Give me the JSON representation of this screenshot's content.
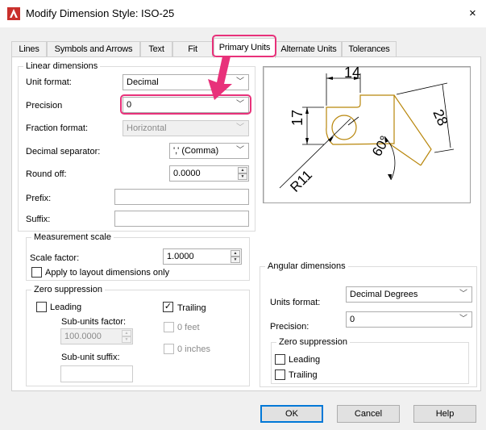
{
  "window": {
    "title": "Modify Dimension Style: ISO-25",
    "close": "×"
  },
  "tabs": [
    {
      "label": "Lines",
      "active": false
    },
    {
      "label": "Symbols and Arrows",
      "active": false
    },
    {
      "label": "Text",
      "active": false
    },
    {
      "label": "Fit",
      "active": false
    },
    {
      "label": "Primary Units",
      "active": true
    },
    {
      "label": "Alternate Units",
      "active": false
    },
    {
      "label": "Tolerances",
      "active": false
    }
  ],
  "linear": {
    "group_title": "Linear dimensions",
    "unit_format_label": "Unit format:",
    "unit_format_value": "Decimal",
    "precision_label": "Precision",
    "precision_value": "0",
    "fraction_format_label": "Fraction format:",
    "fraction_format_value": "Horizontal",
    "decimal_separator_label": "Decimal separator:",
    "decimal_separator_value": "',' (Comma)",
    "round_off_label": "Round off:",
    "round_off_value": "0.0000",
    "prefix_label": "Prefix:",
    "prefix_value": "",
    "suffix_label": "Suffix:",
    "suffix_value": ""
  },
  "measurement": {
    "group_title": "Measurement scale",
    "scale_factor_label": "Scale factor:",
    "scale_factor_value": "1.0000",
    "apply_layout_label": "Apply to layout dimensions only",
    "apply_layout_checked": false
  },
  "zero_suppression_linear": {
    "group_title": "Zero suppression",
    "leading_label": "Leading",
    "leading_checked": false,
    "trailing_label": "Trailing",
    "trailing_checked": true,
    "check_mark": "✓",
    "subunits_factor_label": "Sub-units factor:",
    "subunits_factor_value": "100.0000",
    "feet_label": "0 feet",
    "inches_label": "0 inches",
    "subunit_suffix_label": "Sub-unit suffix:",
    "subunit_suffix_value": ""
  },
  "angular": {
    "group_title": "Angular dimensions",
    "units_format_label": "Units format:",
    "units_format_value": "Decimal Degrees",
    "precision_label": "Precision:",
    "precision_value": "0",
    "zero_group_title": "Zero suppression",
    "leading_label": "Leading",
    "leading_checked": false,
    "trailing_label": "Trailing",
    "trailing_checked": false
  },
  "preview": {
    "dim_top": "14",
    "dim_left": "17",
    "dim_angle": "60°",
    "dim_diag": "28",
    "dim_radius": "R11"
  },
  "buttons": {
    "ok": "OK",
    "cancel": "Cancel",
    "help": "Help"
  },
  "colors": {
    "highlight": "#e8317a",
    "accent": "#0078d7",
    "preview_shape": "#b8860b"
  }
}
